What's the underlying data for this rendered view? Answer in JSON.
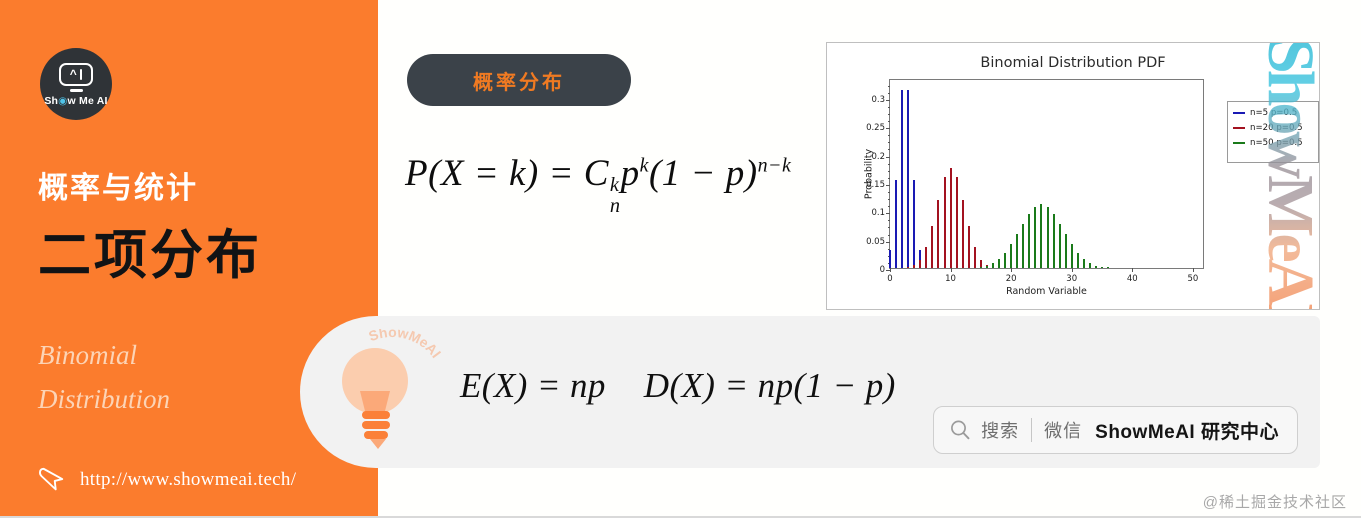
{
  "sidebar": {
    "logo": {
      "icon": "showmeai-robot-icon",
      "wordmark_pre": "Sh",
      "wordmark_dot": "◉",
      "wordmark_post": "w Me AI"
    },
    "kicker": "概率与统计",
    "headline": "二项分布",
    "subtitle_line1": "Binomial",
    "subtitle_line2": "Distribution",
    "url": "http://www.showmeai.tech/",
    "cursor_icon": "cursor-pointer-icon",
    "bg_color": "#FB7C2D",
    "headline_color": "#111315",
    "subtitle_color": "#FCD4B6"
  },
  "pill_tag": {
    "label": "概率分布",
    "bg_color": "#3B4249",
    "text_color": "#F07A22"
  },
  "formula_main": {
    "lhs": "P(X = k) = ",
    "comb_symbol": "C",
    "comb_sup": "k",
    "comb_sub": "n",
    "term_p": "p",
    "term_p_sup": "k",
    "tail": "(1 − p)",
    "tail_sup": "n−k",
    "plain": "P(X = k) = C_n^k p^k (1 − p)^{n−k}"
  },
  "bottom_card": {
    "bulb_icon": "lightbulb-icon",
    "bulb_curve_text": "ShowMeAI",
    "formula_expectation": "E(X) = np",
    "formula_variance": "D(X) = np(1 − p)",
    "bg_color": "#F2F2F2"
  },
  "search_badge": {
    "magnifier_icon": "search-icon",
    "search_label": "搜索",
    "divider": "|",
    "wechat_label": "微信",
    "brand": "ShowMeAI 研究中心"
  },
  "corner_watermark": "@稀土掘金技术社区",
  "chart_watermark": "ShowMeAI",
  "chart_data": {
    "type": "bar",
    "title": "Binomial Distribution PDF",
    "xlabel": "Random Variable",
    "ylabel": "Probability",
    "xlim": [
      0,
      52
    ],
    "ylim": [
      0,
      0.335
    ],
    "xticks": [
      0,
      10,
      20,
      30,
      40,
      50
    ],
    "yticks": [
      0,
      0.05,
      0.1,
      0.15,
      0.2,
      0.25,
      0.3
    ],
    "ytick_labels": [
      "0",
      "0.05",
      "0.1",
      "0.15",
      "0.2",
      "0.25",
      "0.3"
    ],
    "grid": false,
    "legend_position": "upper right outside",
    "series": [
      {
        "name": "n=5 p=0.5",
        "color": "#1A1AB4",
        "x": [
          0,
          1,
          2,
          3,
          4,
          5
        ],
        "values": [
          0.031,
          0.156,
          0.313,
          0.313,
          0.156,
          0.031
        ]
      },
      {
        "name": "n=20 p=0.5",
        "color": "#A31220",
        "x": [
          0,
          1,
          2,
          3,
          4,
          5,
          6,
          7,
          8,
          9,
          10,
          11,
          12,
          13,
          14,
          15,
          16,
          17,
          18,
          19,
          20
        ],
        "values": [
          0.0,
          0.0,
          0.0,
          0.001,
          0.005,
          0.015,
          0.037,
          0.074,
          0.12,
          0.16,
          0.176,
          0.16,
          0.12,
          0.074,
          0.037,
          0.015,
          0.005,
          0.001,
          0.0,
          0.0,
          0.0
        ]
      },
      {
        "name": "n=50 p=0.5",
        "color": "#1A7A1A",
        "x": [
          15,
          16,
          17,
          18,
          19,
          20,
          21,
          22,
          23,
          24,
          25,
          26,
          27,
          28,
          29,
          30,
          31,
          32,
          33,
          34,
          35,
          36
        ],
        "values": [
          0.002,
          0.004,
          0.009,
          0.016,
          0.027,
          0.042,
          0.06,
          0.078,
          0.096,
          0.108,
          0.112,
          0.108,
          0.096,
          0.078,
          0.06,
          0.042,
          0.027,
          0.016,
          0.009,
          0.004,
          0.002,
          0.001
        ]
      }
    ]
  }
}
